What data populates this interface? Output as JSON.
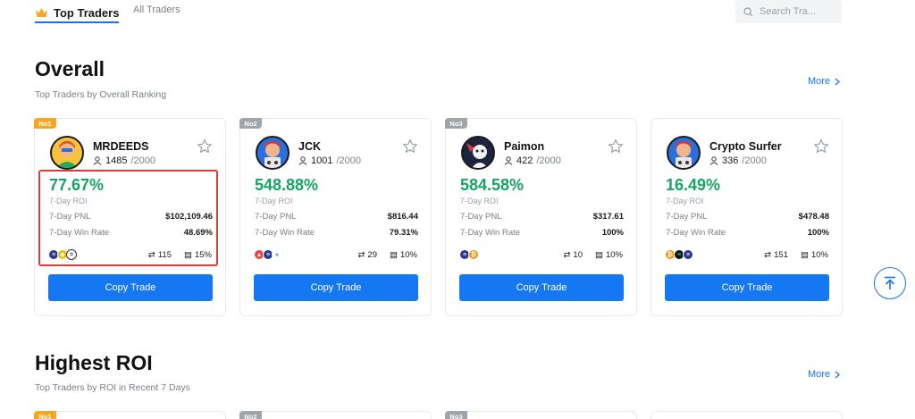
{
  "nav": {
    "tabs": [
      {
        "label": "Top Traders",
        "active": true
      },
      {
        "label": "All Traders",
        "active": false
      }
    ],
    "search": {
      "placeholder": "Search Tra..."
    }
  },
  "sections": [
    {
      "title": "Overall",
      "subtitle": "Top Traders by Overall Ranking",
      "more": "More"
    },
    {
      "title": "Highest ROI",
      "subtitle": "Top Traders by ROI in Recent 7 Days",
      "more": "More"
    }
  ],
  "colors": {
    "accent": "#1677f2",
    "positive": "#16a364",
    "rank1": "#f5a623",
    "rank_other": "#a0a4ab",
    "highlight": "#e53935"
  },
  "cards": [
    {
      "rank": "No1",
      "name": "MRDEEDS",
      "followers": "1485",
      "followers_max": "/2000",
      "roi": "77.67%",
      "roi_label": "7-Day ROI",
      "pnl_label": "7-Day PNL",
      "pnl": "$102,109.46",
      "winrate_label": "7-Day Win Rate",
      "winrate": "48.69%",
      "trades": "115",
      "share": "15%",
      "copy_label": "Copy Trade",
      "coins": [
        "eth-icon",
        "bnb-icon",
        "generic-coin-icon"
      ]
    },
    {
      "rank": "No2",
      "name": "JCK",
      "followers": "1001",
      "followers_max": "/2000",
      "roi": "548.88%",
      "roi_label": "7-Day ROI",
      "pnl_label": "7-Day PNL",
      "pnl": "$816.44",
      "winrate_label": "7-Day Win Rate",
      "winrate": "79.31%",
      "trades": "29",
      "share": "10%",
      "copy_label": "Copy Trade",
      "coins": [
        "avax-icon",
        "eth-icon",
        "water-drop-icon"
      ]
    },
    {
      "rank": "No3",
      "name": "Paimon",
      "followers": "422",
      "followers_max": "/2000",
      "roi": "584.58%",
      "roi_label": "7-Day ROI",
      "pnl_label": "7-Day PNL",
      "pnl": "$317.61",
      "winrate_label": "7-Day Win Rate",
      "winrate": "100%",
      "trades": "10",
      "share": "10%",
      "copy_label": "Copy Trade",
      "coins": [
        "eth-icon",
        "btc-icon"
      ]
    },
    {
      "rank": "",
      "name": "Crypto Surfer",
      "followers": "336",
      "followers_max": "/2000",
      "roi": "16.49%",
      "roi_label": "7-Day ROI",
      "pnl_label": "7-Day PNL",
      "pnl": "$478.48",
      "winrate_label": "7-Day Win Rate",
      "winrate": "100%",
      "trades": "151",
      "share": "10%",
      "copy_label": "Copy Trade",
      "coins": [
        "btc-icon",
        "solana-icon",
        "eth-icon"
      ]
    }
  ],
  "roi_cards": [
    {
      "rank": "No1"
    },
    {
      "rank": "No2"
    },
    {
      "rank": "No3"
    },
    {
      "rank": ""
    }
  ]
}
